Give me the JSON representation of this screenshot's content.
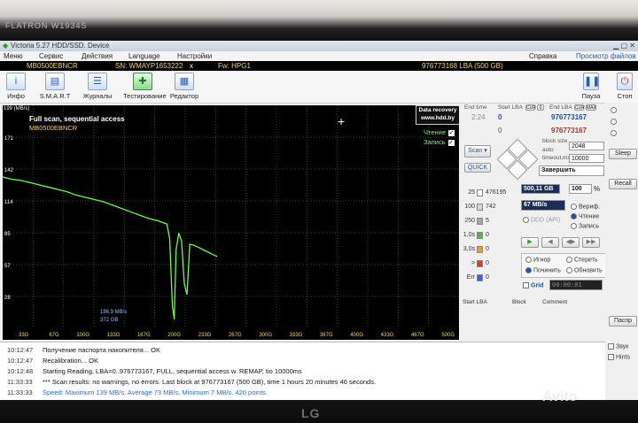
{
  "bezel": {
    "brand": "FLATRON W1934S",
    "maker": "LG",
    "watermark": "Avito"
  },
  "window": {
    "title": "Victoria 5.27 HDD/SSD. Device"
  },
  "menu": {
    "items": [
      "Меню",
      "Сервис",
      "Действия",
      "Language",
      "Настройки"
    ],
    "right_items": [
      "Справка",
      "Просмотр файлов"
    ]
  },
  "info": {
    "model": "MB0500EBNCR",
    "serial": "SN: WMAYP1653222",
    "close": "x",
    "firmware": "Fw: HPG1",
    "capacity": "976773168 LBA (500 GB)"
  },
  "toolbar": {
    "items": [
      {
        "label": "Инфо",
        "icon": "info-icon"
      },
      {
        "label": "S.M.A.R.T",
        "icon": "smart-icon"
      },
      {
        "label": "Журналы",
        "icon": "logs-icon"
      },
      {
        "label": "Тестирование",
        "icon": "test-icon"
      },
      {
        "label": "Редактор",
        "icon": "editor-icon"
      }
    ],
    "pause": "Пауза",
    "stop": "Стоп"
  },
  "graph": {
    "title": "Full scan, sequential access",
    "model": "MB0500EBNCR",
    "units": "199 (MB/s)",
    "brand_line1": "Data recovery",
    "brand_line2": "www.hdd.by",
    "read_label": "Чтение",
    "write_label": "Запись",
    "cursor_speed": "186,9 MB/s",
    "cursor_pos": "372 GB"
  },
  "chart_data": {
    "type": "line",
    "title": "Full scan, sequential access",
    "ylabel": "MB/s",
    "ylim": [
      0,
      199
    ],
    "xlim": [
      0,
      500
    ],
    "y_ticks": [
      "199 (MB/s)",
      "171",
      "142",
      "114",
      "85",
      "57",
      "28"
    ],
    "x_ticks": [
      "33G",
      "67G",
      "100G",
      "133G",
      "167G",
      "200G",
      "233G",
      "267G",
      "300G",
      "333G",
      "367G",
      "400G",
      "433G",
      "467G",
      "500G"
    ],
    "series": [
      {
        "name": "Чтение",
        "x": [
          0,
          10,
          20,
          30,
          40,
          50,
          60,
          70,
          80,
          90,
          100,
          110,
          120,
          130,
          140,
          150,
          160,
          170,
          180,
          183,
          186,
          188,
          190,
          193,
          196,
          199,
          202,
          205,
          210,
          215,
          220,
          225,
          230,
          235
        ],
        "y": [
          135,
          133,
          132,
          130,
          128,
          126,
          124,
          122,
          119,
          117,
          115,
          113,
          110,
          107,
          104,
          101,
          98,
          96,
          93,
          80,
          20,
          8,
          70,
          85,
          78,
          40,
          30,
          75,
          74,
          72,
          70,
          68,
          66,
          64
        ]
      }
    ]
  },
  "scan": {
    "end_time_label": "End time",
    "end_time": "2:24",
    "start_lba_label": "Start LBA",
    "start_lba": "0",
    "cur_label": "CUR",
    "zero_label": "0",
    "end_lba_label": "End LBA",
    "end_lba": "976773167",
    "end_lba2": "976773167",
    "start_lba2": "0",
    "max_label": "MAX",
    "scan_button": "Scan",
    "quick_button": "QUICK",
    "block_size_label": "block size",
    "auto_label": "auto",
    "block_size": "2048",
    "timeout_label": "timeout,ms",
    "timeout": "10000",
    "action": "Завершить",
    "total_size": "500,11 GB",
    "percent": "100",
    "percent_unit": "%",
    "speed": "67 MB/s"
  },
  "blocks": [
    {
      "threshold": "25",
      "count": "476195",
      "color": "#ffffff"
    },
    {
      "threshold": "100",
      "count": "742",
      "color": "#d8d8d8"
    },
    {
      "threshold": "250",
      "count": "5",
      "color": "#a8a8a8"
    },
    {
      "threshold": "1,0s",
      "count": "0",
      "color": "#33cc33"
    },
    {
      "threshold": "3,0s",
      "count": "0",
      "color": "#ff9a00"
    },
    {
      "threshold": ">",
      "count": "0",
      "color": "#ff3300"
    },
    {
      "threshold": "Err",
      "count": "0",
      "color": "#3060ff"
    }
  ],
  "modes": {
    "verify": "Вериф.",
    "read": "Чтение",
    "write": "Запись",
    "ddd": "DDD (API)"
  },
  "repair": {
    "ignore": "Игнор",
    "erase": "Стереть",
    "remap": "Починить",
    "refresh": "Обновить"
  },
  "grid": {
    "label": "Grid",
    "timer": "00:00:01"
  },
  "tabs": {
    "start_lba": "Start LBA",
    "block": "Block",
    "comment": "Comment"
  },
  "fcol": {
    "sleep": "Sleep",
    "recall": "Recall",
    "passp": "Паспр",
    "sound": "Звук",
    "hints": "Hints"
  },
  "log": [
    {
      "time": "10:12:47",
      "text": "Получение паспорта накопителя... OK",
      "blue": false
    },
    {
      "time": "10:12:47",
      "text": "Recalibration... OK",
      "blue": false
    },
    {
      "time": "10:12:48",
      "text": "Starting Reading, LBA=0..976773167, FULL, sequential access w. REMAP, tio 10000ms",
      "blue": false
    },
    {
      "time": "11:33:33",
      "text": "*** Scan results: no warnings, no errors. Last block at 976773167 (500 GB), time 1 hours 20 minutes 46 seconds.",
      "blue": false
    },
    {
      "time": "11:33:33",
      "text": "Speed: Maximum 139 MB/s. Average 73 MB/s. Minimum 7 MB/s. 420 points.",
      "blue": true
    }
  ]
}
